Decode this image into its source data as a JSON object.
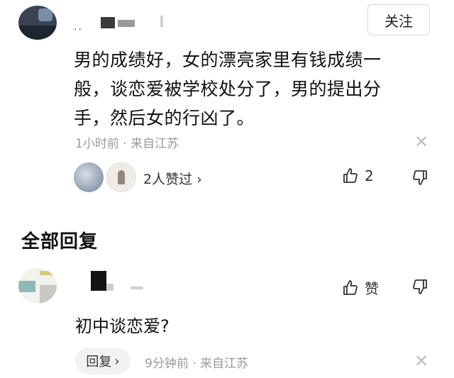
{
  "comment": {
    "follow_label": "关注",
    "name_text": "..",
    "text": "男的成绩好，女的漂亮家里有钱成绩一般，谈恋爱被学校处分了，男的提出分手，然后女的行凶了。",
    "time": "1小时前",
    "location": "来自江苏",
    "likers_text": "2人赞过",
    "like_count": "2"
  },
  "section_title": "全部回复",
  "reply": {
    "like_label": "赞",
    "text": "初中谈恋爱?",
    "reply_label": "回复",
    "time": "9分钟前",
    "location": "来自江苏"
  },
  "icons": {
    "dot_separator": "·",
    "chevron": "›",
    "close": "✕"
  }
}
